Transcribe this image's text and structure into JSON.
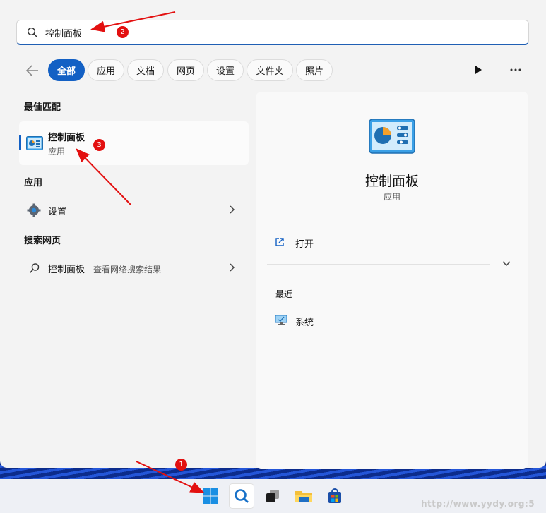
{
  "search": {
    "value": "控制面板",
    "placeholder": ""
  },
  "filters": [
    "全部",
    "应用",
    "文档",
    "网页",
    "设置",
    "文件夹",
    "照片"
  ],
  "sections": {
    "best_match": "最佳匹配",
    "apps": "应用",
    "web": "搜索网页"
  },
  "best_match": {
    "title": "控制面板",
    "subtitle": "应用"
  },
  "app_results": [
    {
      "label": "设置"
    }
  ],
  "web_results": [
    {
      "label": "控制面板",
      "suffix": " - 查看网络搜索结果"
    }
  ],
  "detail": {
    "title": "控制面板",
    "subtitle": "应用",
    "open_label": "打开",
    "recent_header": "最近",
    "recent_items": [
      "系统"
    ]
  },
  "annotations": [
    "1",
    "2",
    "3"
  ],
  "watermark": "http://www.yydy.org:5",
  "colors": {
    "accent": "#1360c4",
    "annotation": "#e31010"
  }
}
